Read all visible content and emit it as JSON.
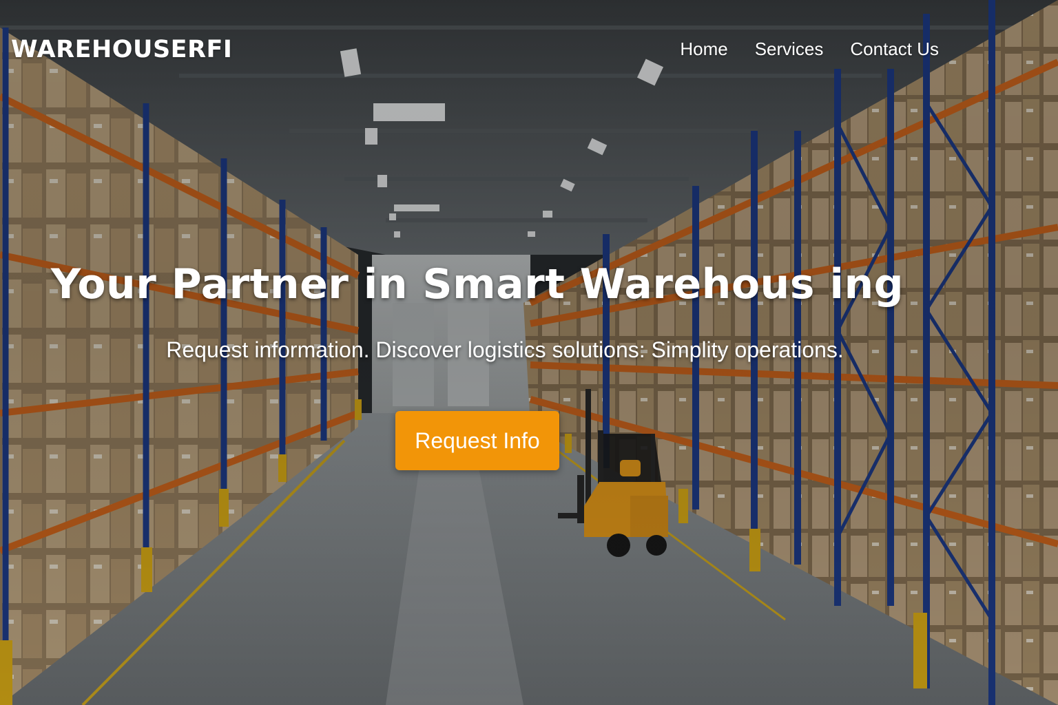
{
  "brand": {
    "logo_text": "WAREHOUSERFI"
  },
  "nav": {
    "items": [
      {
        "label": "Home"
      },
      {
        "label": "Services"
      },
      {
        "label": "Contact Us"
      }
    ]
  },
  "hero": {
    "headline": "Your Partner in Smart Warehous ing",
    "subheadline": "Request information. Discover logistics solutions: Simplity operations.",
    "cta_label": "Request Info",
    "background": "warehouse-aisle-photo"
  },
  "colors": {
    "accent": "#f29508",
    "text": "#ffffff",
    "rack_blue": "#1f3e8f",
    "rack_orange": "#d86a1e"
  }
}
